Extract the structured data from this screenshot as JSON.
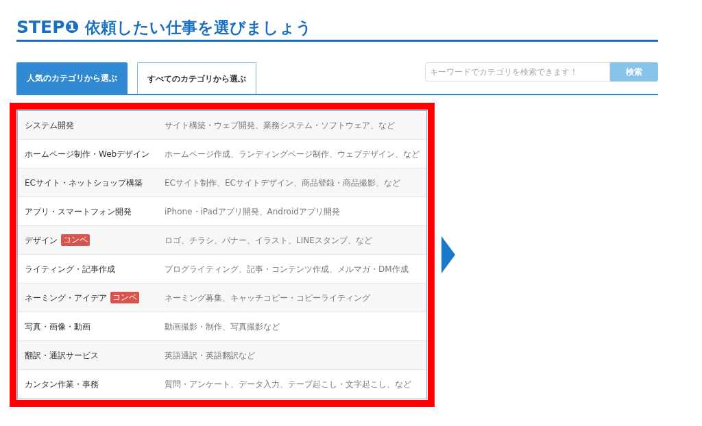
{
  "heading": {
    "step": "STEP❶",
    "title": "依頼したい仕事を選びましょう"
  },
  "tabs": [
    {
      "label": "人気のカテゴリから選ぶ",
      "selected": true
    },
    {
      "label": "すべてのカテゴリから選ぶ",
      "selected": false
    }
  ],
  "search": {
    "placeholder": "キーワードでカテゴリを検索できます！",
    "button": "検索"
  },
  "categories": [
    {
      "name": "システム開発",
      "examples": "サイト構築・ウェブ開発、業務システム・ソフトウェア、など"
    },
    {
      "name": "ホームページ制作・Webデザイン",
      "examples": "ホームページ作成、ランディングページ制作、ウェブデザイン、など"
    },
    {
      "name": "ECサイト・ネットショップ構築",
      "examples": "ECサイト制作、ECサイトデザイン、商品登録・商品撮影、など"
    },
    {
      "name": "アプリ・スマートフォン開発",
      "examples": "iPhone・iPadアプリ開発、Androidアプリ開発"
    },
    {
      "name": "デザイン",
      "badge": "コンペ",
      "examples": "ロゴ、チラシ、バナー、イラスト、LINEスタンプ、など"
    },
    {
      "name": "ライティング・記事作成",
      "examples": "ブログライティング、記事・コンテンツ作成、メルマガ・DM作成"
    },
    {
      "name": "ネーミング・アイデア",
      "badge": "コンペ",
      "examples": "ネーミング募集、キャッチコピー・コピーライティング"
    },
    {
      "name": "写真・画像・動画",
      "examples": "動画撮影・制作、写真撮影など"
    },
    {
      "name": "翻訳・通訳サービス",
      "examples": "英語通訳・英語翻訳など"
    },
    {
      "name": "カンタン作業・事務",
      "examples": "質問・アンケート、データ入力、テープ起こし・文字起こし、など"
    }
  ]
}
